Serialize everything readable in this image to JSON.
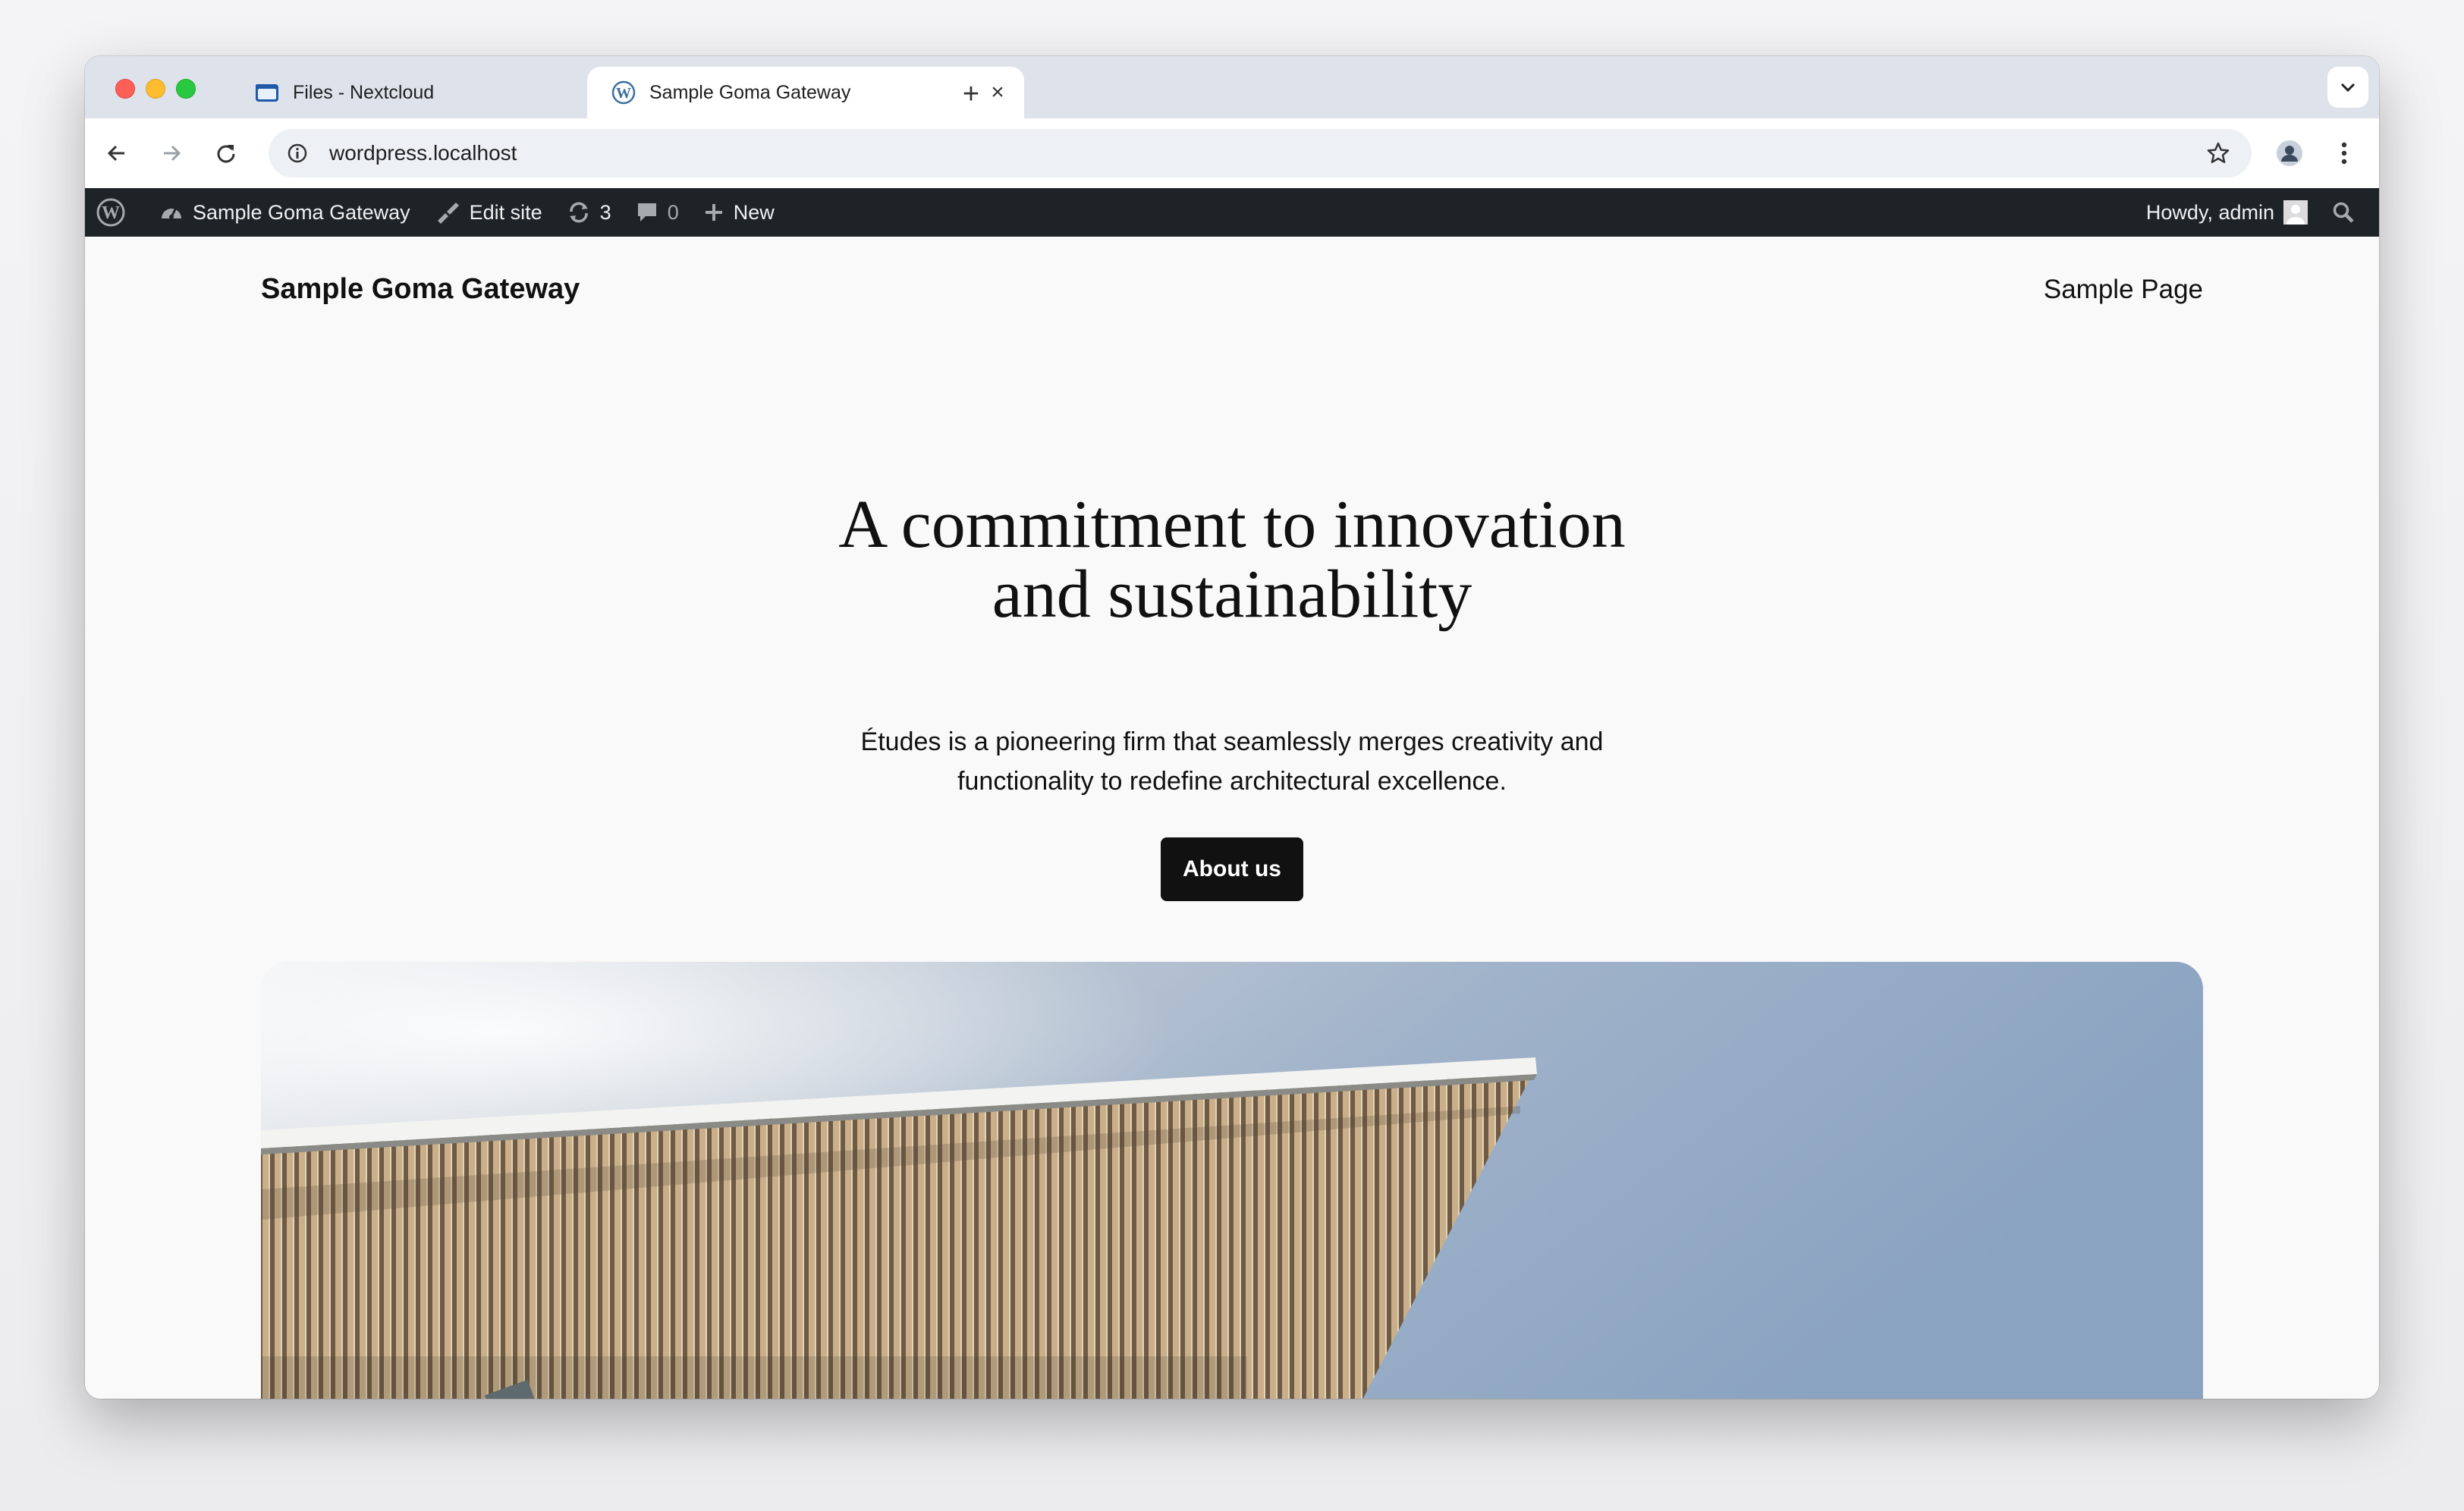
{
  "browser": {
    "tabs": [
      {
        "title": "Files - Nextcloud",
        "icon": "folder-icon",
        "active": false
      },
      {
        "title": "Sample Goma Gateway",
        "icon": "wordpress-icon",
        "active": true
      }
    ],
    "address": "wordpress.localhost"
  },
  "adminbar": {
    "site_name": "Sample Goma Gateway",
    "edit_site": "Edit site",
    "updates_count": "3",
    "comments_count": "0",
    "new_label": "New",
    "greeting": "Howdy, admin"
  },
  "site": {
    "title": "Sample Goma Gateway",
    "nav": [
      "Sample Page"
    ]
  },
  "hero": {
    "title_line1": "A commitment to innovation",
    "title_line2": "and sustainability",
    "subtitle_line1": "Études is a pioneering firm that seamlessly merges creativity and",
    "subtitle_line2": "functionality to redefine architectural excellence.",
    "cta_label": "About us"
  },
  "colors": {
    "admin_bar": "#1d2327",
    "button": "#111111",
    "page_bg": "#f9f9f9",
    "tab_strip": "#dee3eb"
  }
}
